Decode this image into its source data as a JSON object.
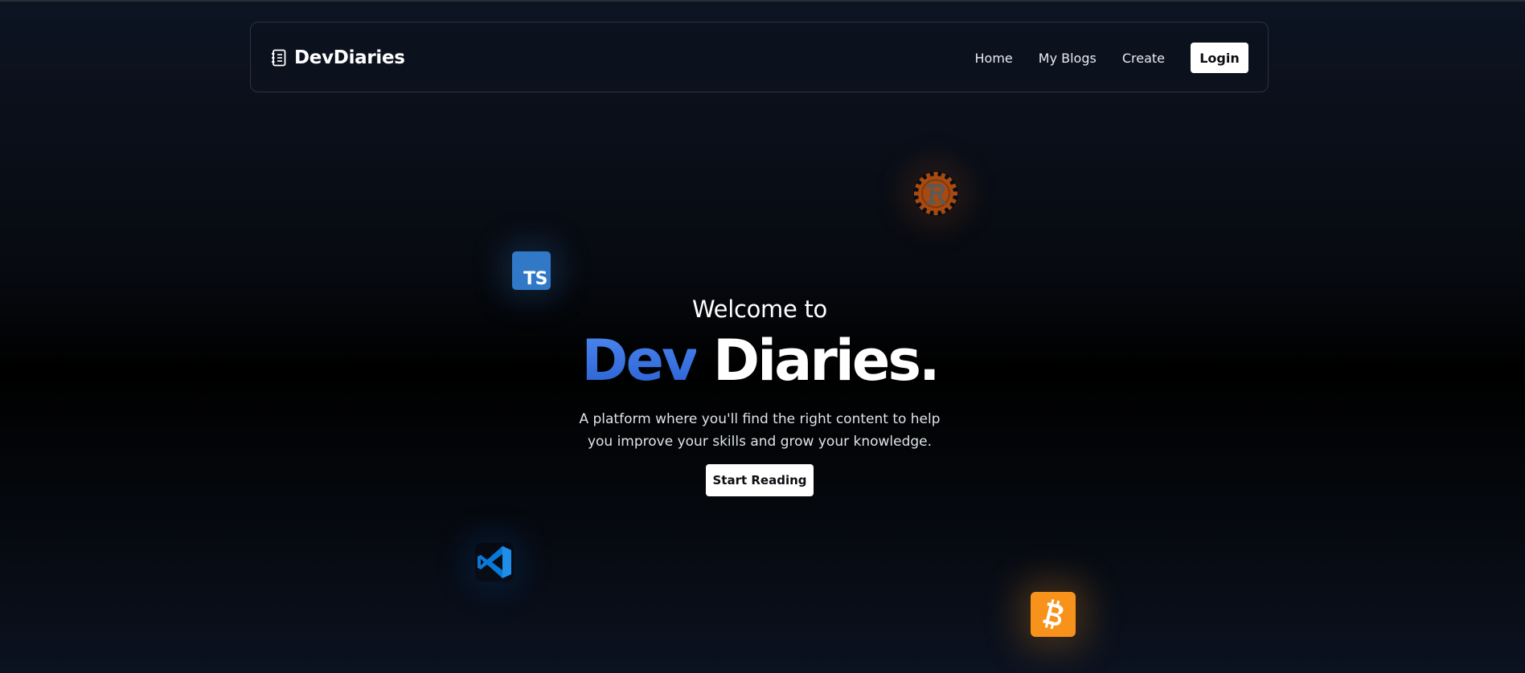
{
  "brand": {
    "name": "DevDiaries",
    "icon": "notebook-icon"
  },
  "nav": {
    "links": [
      "Home",
      "My Blogs",
      "Create"
    ],
    "login_label": "Login"
  },
  "hero": {
    "welcome": "Welcome to",
    "title_accent": "Dev",
    "title_rest": "Diaries.",
    "description": "A platform where you'll find the right content to help you improve your skills and grow your knowledge.",
    "cta_label": "Start Reading"
  },
  "floating_logos": {
    "typescript": {
      "icon": "typescript-logo-icon",
      "text": "TS",
      "color": "#3178c6"
    },
    "rust": {
      "icon": "rust-logo-icon",
      "color": "#b7410e"
    },
    "vscode": {
      "icon": "vscode-logo-icon",
      "color": "#0078d4"
    },
    "bitcoin": {
      "icon": "bitcoin-logo-icon",
      "color": "#f7931a"
    }
  },
  "colors": {
    "accent": "#3a72e6",
    "background": "#000000"
  }
}
